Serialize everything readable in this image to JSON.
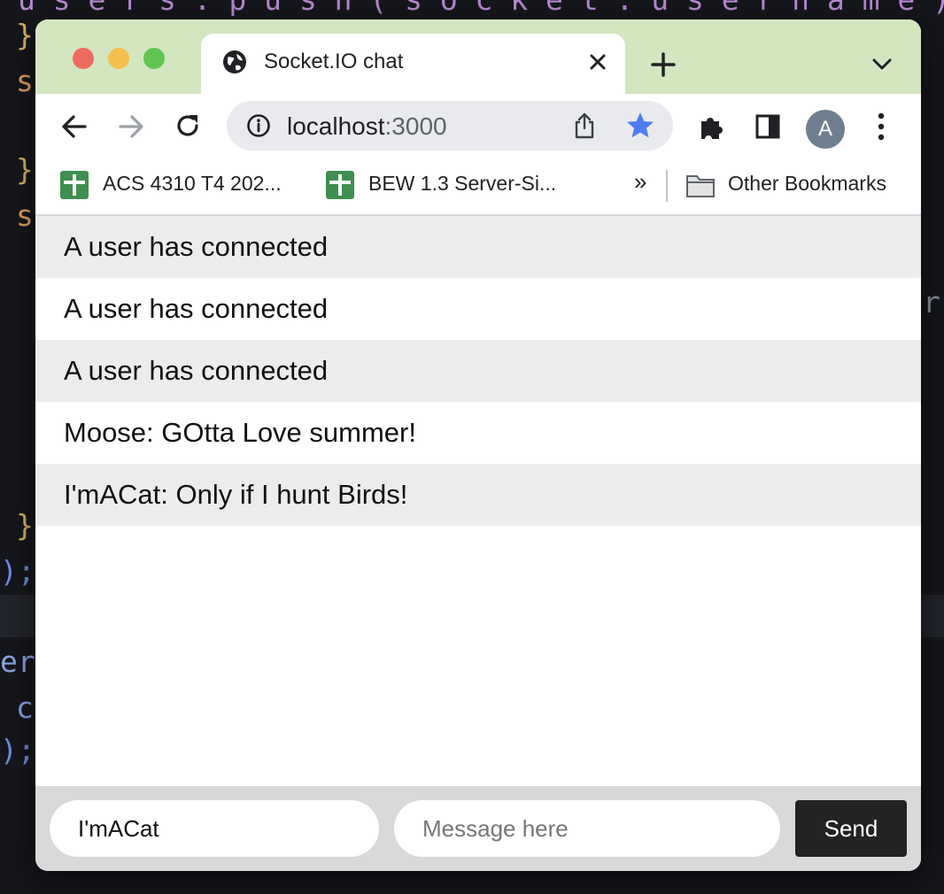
{
  "background_code": [
    "u s e r s . p u s h ( s o c k e t . u s e r n a m e ) ;",
    "}",
    "s",
    "}",
    "s",
    "r",
    "}",
    ");",
    "er",
    "c",
    ");"
  ],
  "window": {
    "tab": {
      "title": "Socket.IO chat"
    },
    "address_bar": {
      "host": "localhost",
      "port": ":3000"
    },
    "profile_initial": "A",
    "bookmarks": {
      "items": [
        {
          "label": "ACS 4310 T4 202..."
        },
        {
          "label": "BEW 1.3 Server-Si..."
        }
      ],
      "overflow": "»",
      "other_label": "Other Bookmarks"
    },
    "colors": {
      "tabstrip": "#d3e6c0",
      "star": "#4f7df0",
      "send_button": "#232323"
    }
  },
  "chat": {
    "messages": [
      "A user has connected",
      "A user has connected",
      "A user has connected",
      "Moose: GOtta Love summer!",
      "I'mACat: Only if I hunt Birds!"
    ],
    "username_value": "I'mACat",
    "message_placeholder": "Message here",
    "send_label": "Send"
  }
}
